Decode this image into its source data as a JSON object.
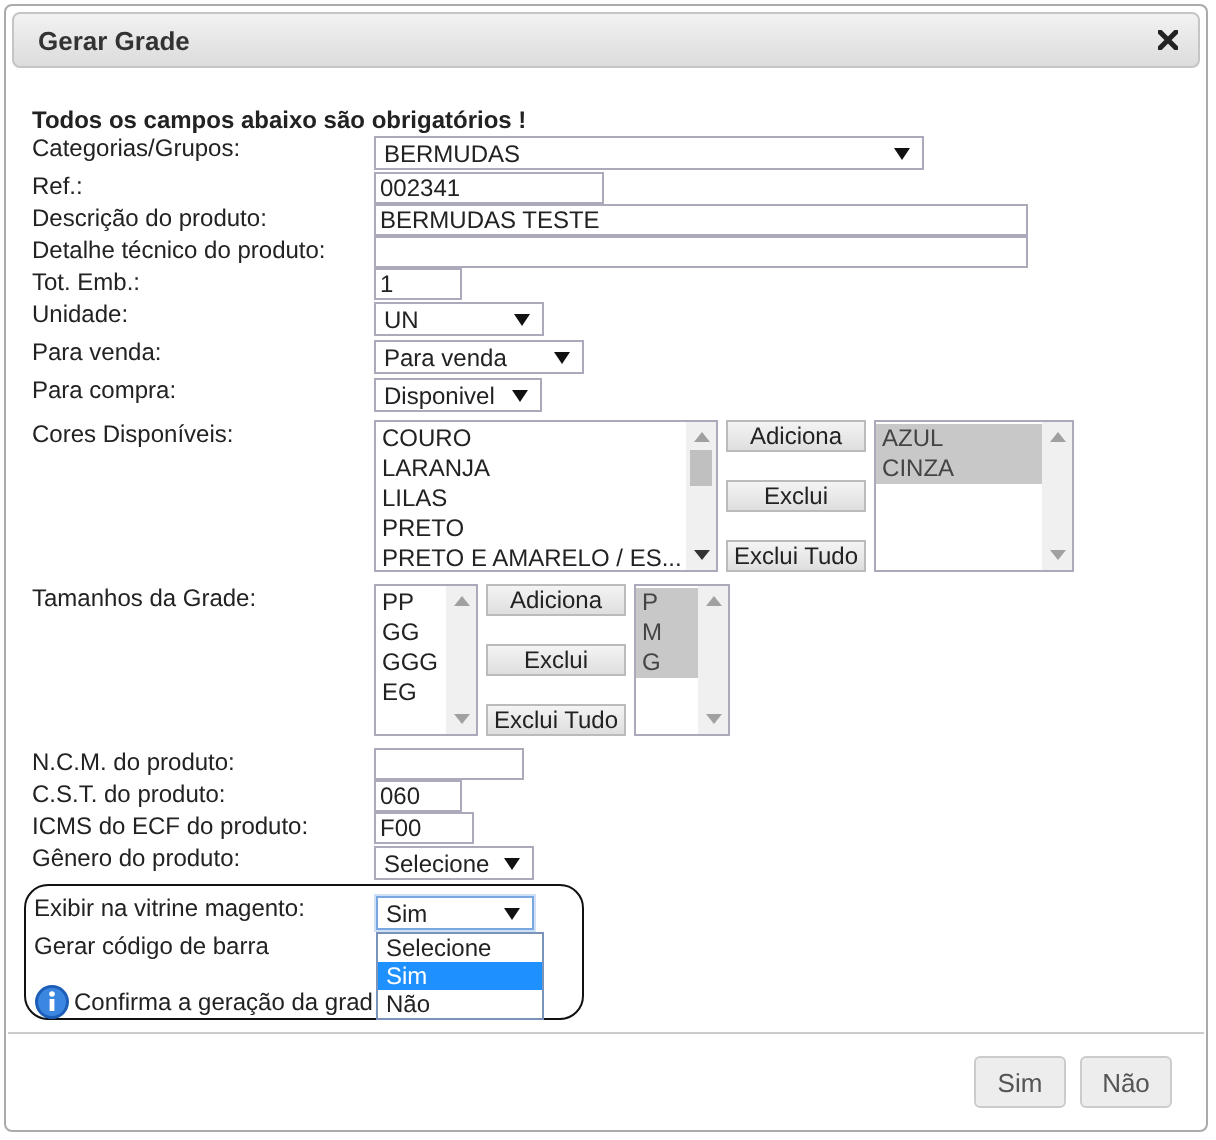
{
  "dialog": {
    "title": "Gerar Grade"
  },
  "heading": "Todos os campos abaixo são obrigatórios !",
  "fields": [
    {
      "kind": "select",
      "label": "Categorias/Grupos:",
      "value": "BERMUDAS"
    },
    {
      "kind": "input",
      "label": "Ref.:",
      "value": "002341"
    },
    {
      "kind": "input",
      "label": "Descrição do produto:",
      "value": "BERMUDAS TESTE"
    },
    {
      "kind": "input",
      "label": "Detalhe técnico do produto:"
    },
    {
      "kind": "input",
      "label": "Tot. Emb.:",
      "value": "1"
    },
    {
      "kind": "select",
      "label": "Unidade:",
      "value": "UN"
    },
    {
      "kind": "select",
      "label": "Para venda:",
      "value": "Para venda"
    },
    {
      "kind": "select",
      "label": "Para compra:",
      "value": "Disponivel"
    },
    {
      "kind": "dual-list",
      "label": "Cores Disponíveis:",
      "available": [
        {
          "text": "COURO",
          "selected": false
        },
        {
          "text": "LARANJA",
          "selected": false
        },
        {
          "text": "LILAS",
          "selected": false
        },
        {
          "text": "PRETO",
          "selected": false
        },
        {
          "text": "PRETO E AMARELO / ES...",
          "selected": false
        }
      ],
      "buttons": [
        "Adiciona",
        "Exclui",
        "Exclui Tudo"
      ],
      "chosen": [
        {
          "text": "AZUL",
          "selected": true
        },
        {
          "text": "CINZA",
          "selected": true
        }
      ]
    },
    {
      "kind": "dual-list",
      "label": "Tamanhos da Grade:",
      "available": [
        {
          "text": "PP",
          "selected": false
        },
        {
          "text": "GG",
          "selected": false
        },
        {
          "text": "GGG",
          "selected": false
        },
        {
          "text": "EG",
          "selected": false
        }
      ],
      "buttons": [
        "Adiciona",
        "Exclui",
        "Exclui Tudo"
      ],
      "chosen": [
        {
          "text": "P",
          "selected": true
        },
        {
          "text": "M",
          "selected": true
        },
        {
          "text": "G",
          "selected": true
        }
      ]
    },
    {
      "kind": "input",
      "label": "N.C.M. do produto:"
    },
    {
      "kind": "input",
      "label": "C.S.T. do produto:",
      "value": "060"
    },
    {
      "kind": "input",
      "label": "ICMS do ECF do produto:",
      "value": "F00"
    },
    {
      "kind": "select",
      "label": "Gênero do produto:",
      "value": "Selecione"
    }
  ],
  "highlight": {
    "select_label": "Exibir na vitrine magento:",
    "select_value": "Sim",
    "options": [
      {
        "text": "Selecione",
        "selected": false
      },
      {
        "text": "Sim",
        "selected": true
      },
      {
        "text": "Não",
        "selected": false
      }
    ],
    "barcode_label": "Gerar código de barra",
    "confirm": "Confirma a geração da grad"
  },
  "buttons": [
    "Sim",
    "Não"
  ]
}
